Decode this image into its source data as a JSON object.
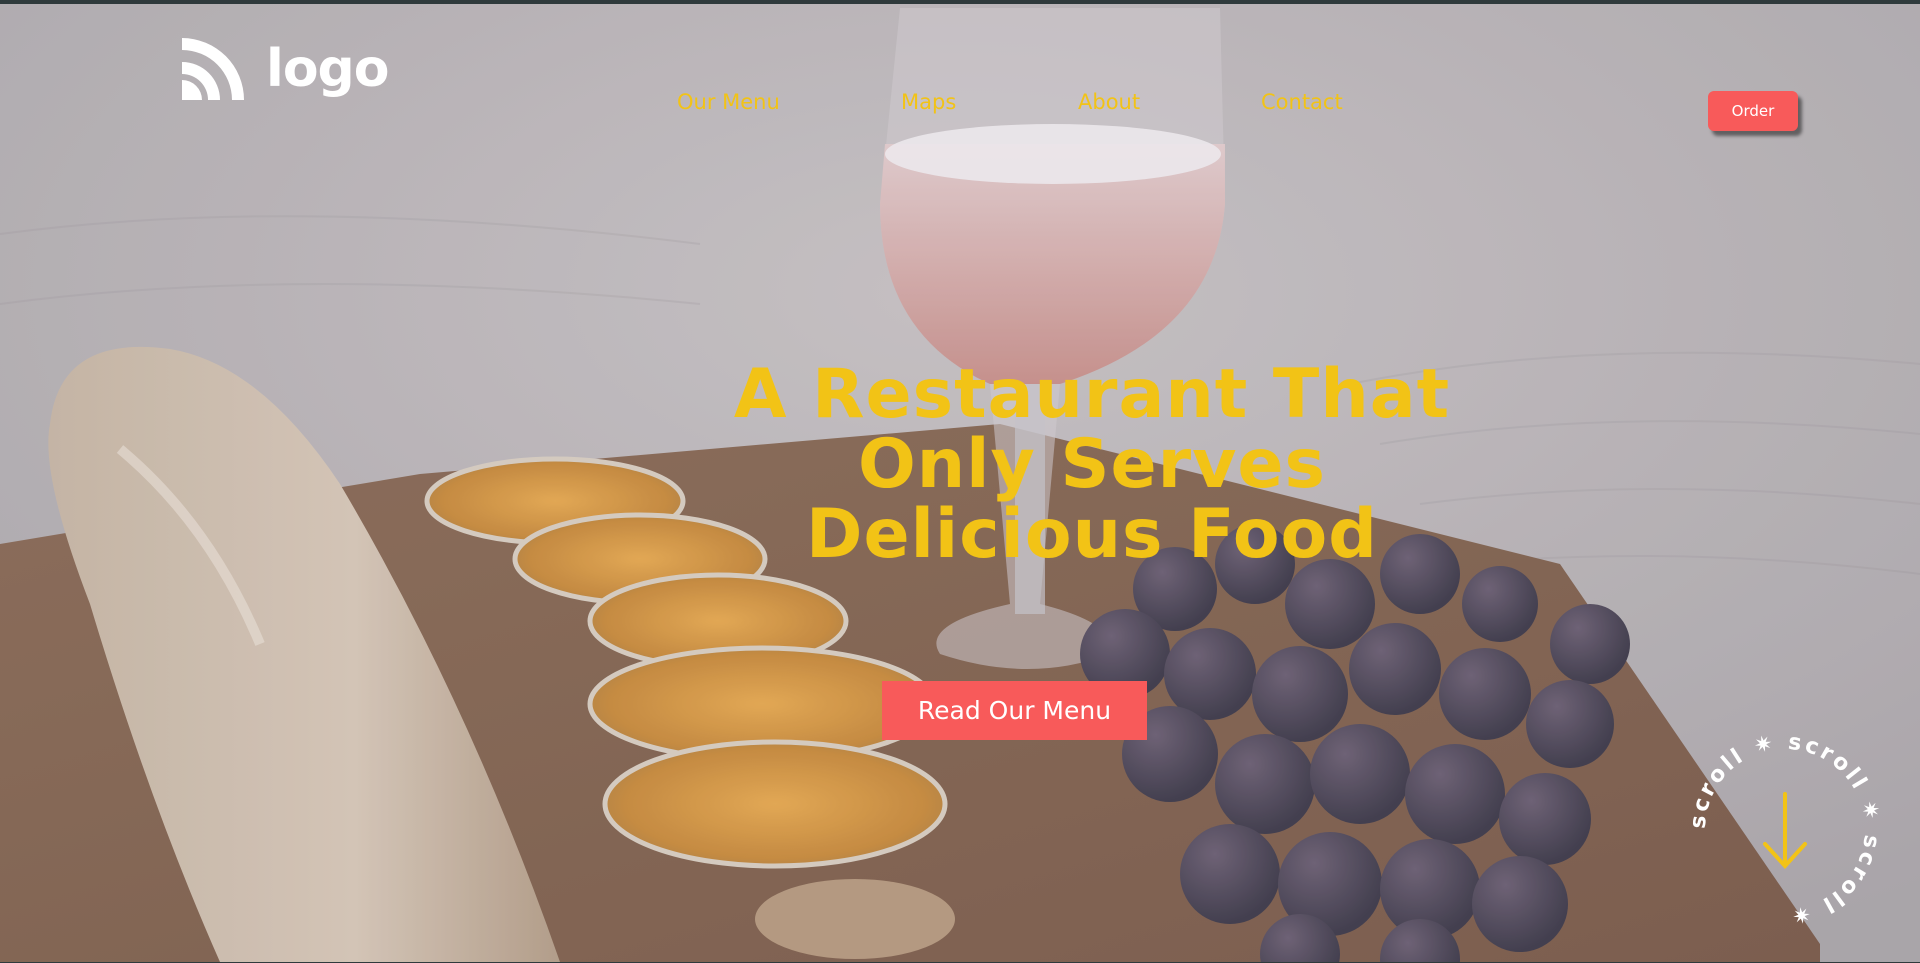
{
  "logo": {
    "text": "logo",
    "icon": "wifi-arcs-logo-icon"
  },
  "nav": {
    "items": [
      {
        "label": "Our Menu"
      },
      {
        "label": "Maps"
      },
      {
        "label": "About"
      },
      {
        "label": "Contact"
      }
    ]
  },
  "header": {
    "order_label": "Order"
  },
  "hero": {
    "headline_lines": [
      "A Restaurant That",
      "Only Serves",
      "Delicious Food"
    ],
    "cta_label": "Read Our Menu",
    "background": "photo of wine glass, baguette, orange slices and grapes on a wooden board"
  },
  "scroll_badge": {
    "text": "scroll ✷ scroll ✷ scroll ✷",
    "icon": "arrow-down-icon"
  },
  "colors": {
    "accent_yellow": "#f2c316",
    "accent_red": "#f85a5a",
    "text_white": "#ffffff"
  }
}
